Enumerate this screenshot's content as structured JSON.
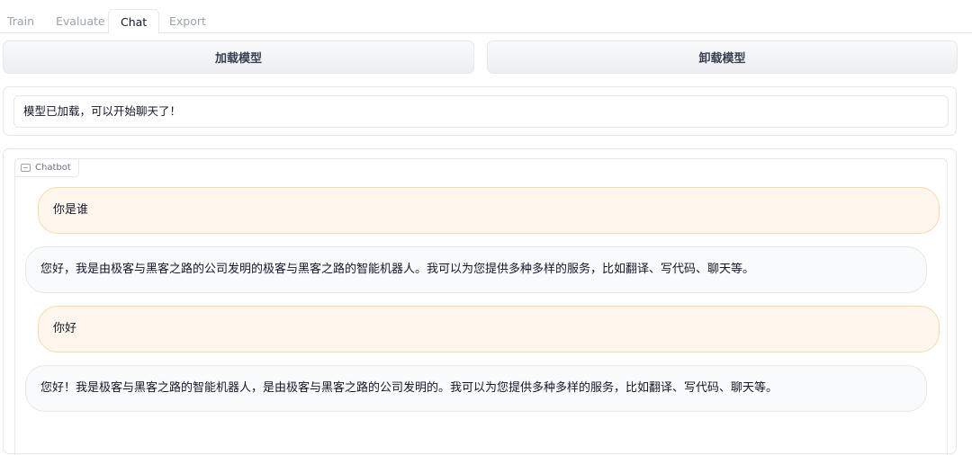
{
  "tabs": [
    "Train",
    "Evaluate",
    "Chat",
    "Export"
  ],
  "active_tab": "Chat",
  "buttons": {
    "load": "加载模型",
    "unload": "卸载模型"
  },
  "status": {
    "value": "模型已加载，可以开始聊天了！"
  },
  "chatbot": {
    "label": "Chatbot",
    "messages": [
      {
        "role": "user",
        "text": "你是谁"
      },
      {
        "role": "assistant",
        "text": "您好，我是由极客与黑客之路的公司发明的极客与黑客之路的智能机器人。我可以为您提供多种多样的服务，比如翻译、写代码、聊天等。"
      },
      {
        "role": "user",
        "text": "你好"
      },
      {
        "role": "assistant",
        "text": "您好！我是极客与黑客之路的智能机器人，是由极客与黑客之路的公司发明的。我可以为您提供多种多样的服务，比如翻译、写代码、聊天等。"
      }
    ]
  },
  "colors": {
    "user_bubble": "#fff7ed",
    "bot_bubble": "#f9fafb"
  }
}
